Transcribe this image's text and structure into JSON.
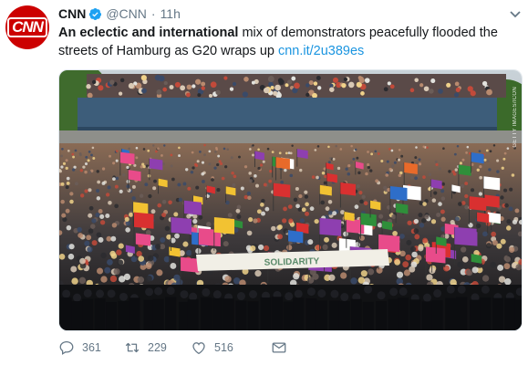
{
  "tweet": {
    "avatar_text": "CNN",
    "display_name": "CNN",
    "handle": "@CNN",
    "separator": "·",
    "time": "11h",
    "text_bold": "An eclectic and international",
    "text_rest": " mix of demonstrators peacefully flooded the streets of Hamburg as G20 wraps up ",
    "link": "cnn.it/2u389es",
    "image_watermark": "GETTY IMAGES/ICON",
    "image_banner_text": "SOLIDARITY"
  },
  "actions": {
    "reply_count": "361",
    "retweet_count": "229",
    "like_count": "516"
  },
  "colors": {
    "brand": "#cc0000",
    "link": "#1b95e0",
    "secondary_text": "#657786",
    "verified": "#1da1f2"
  },
  "icons": [
    "verified-icon",
    "caret-down-icon",
    "reply-icon",
    "retweet-icon",
    "like-icon",
    "message-icon"
  ]
}
